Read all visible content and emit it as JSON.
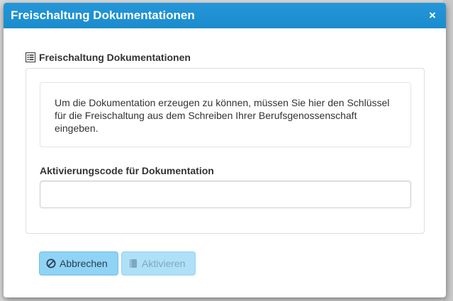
{
  "dialog": {
    "title": "Freischaltung Dokumentationen",
    "close_symbol": "×"
  },
  "section": {
    "heading": "Freischaltung Dokumentationen",
    "icon": "list-alt-icon"
  },
  "info": {
    "text": "Um die Dokumentation erzeugen zu können, müssen Sie hier den Schlüssel für die Freischaltung aus dem Schreiben Ihrer Berufsgenossenschaft eingeben."
  },
  "form": {
    "code_label": "Aktivierungscode für Dokumentation",
    "code_value": "",
    "code_placeholder": ""
  },
  "buttons": {
    "cancel_label": "Abbrechen",
    "cancel_icon": "ban-icon",
    "activate_label": "Aktivieren",
    "activate_icon": "book-icon"
  },
  "colors": {
    "header": "#1b8ccd",
    "cancel_button": "#8fd3f5",
    "activate_button_disabled": "#aee0f8"
  }
}
